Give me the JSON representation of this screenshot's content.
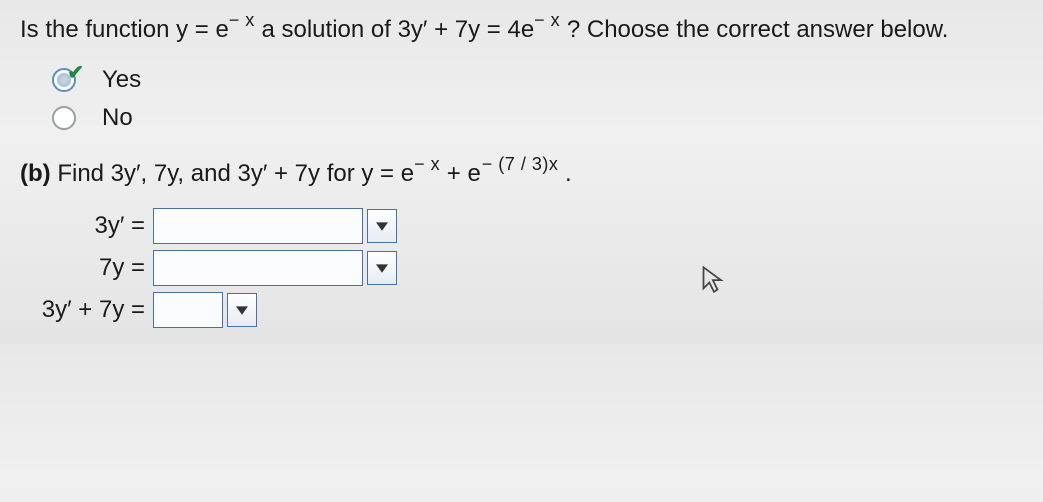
{
  "question": {
    "prefix": "Is the function ",
    "func_lhs": "y = e",
    "func_exp": "− x",
    "mid": " a solution of ",
    "eq_lhs": "3y′ + 7y = 4e",
    "eq_exp": "− x",
    "suffix": "? Choose the correct answer below."
  },
  "options": {
    "yes": "Yes",
    "no": "No",
    "selected": "yes"
  },
  "part_b": {
    "label": "(b)",
    "text_1": " Find 3y′, 7y, and 3y′ + 7y for ",
    "expr_lhs": "y = e",
    "exp1": "− x",
    "plus": " + e",
    "exp2": "− (7 / 3)x",
    "period": "."
  },
  "answers": {
    "row1": {
      "label": "3y′ ="
    },
    "row2": {
      "label": "7y ="
    },
    "row3": {
      "label": "3y′ + 7y ="
    }
  }
}
